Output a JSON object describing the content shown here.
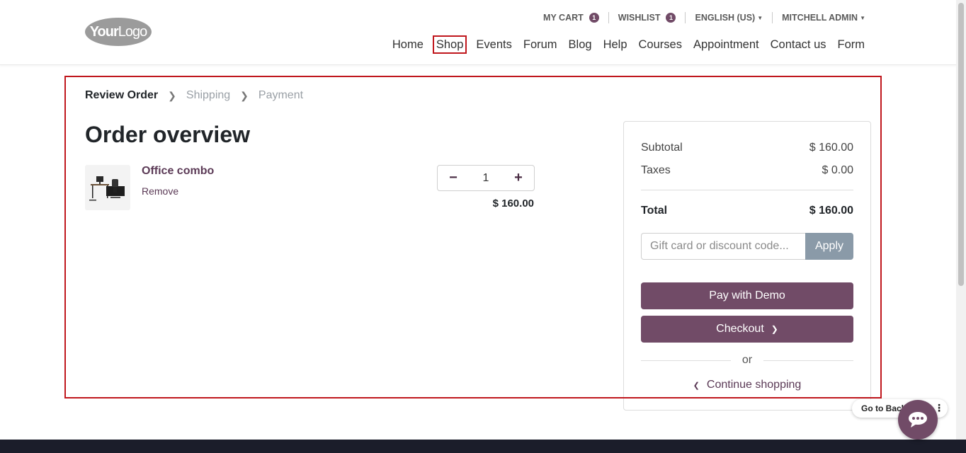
{
  "header": {
    "logo_text_1": "Your",
    "logo_text_2": "Logo",
    "topbar": {
      "cart_label": "MY CART",
      "cart_count": "1",
      "wishlist_label": "WISHLIST",
      "wishlist_count": "1",
      "language": "ENGLISH (US)",
      "user": "MITCHELL ADMIN"
    },
    "nav": [
      "Home",
      "Shop",
      "Events",
      "Forum",
      "Blog",
      "Help",
      "Courses",
      "Appointment",
      "Contact us",
      "Form"
    ]
  },
  "checkout": {
    "steps": [
      "Review Order",
      "Shipping",
      "Payment"
    ],
    "title": "Order overview",
    "line": {
      "name": "Office combo",
      "remove": "Remove",
      "qty": "1",
      "price": "$ 160.00"
    }
  },
  "summary": {
    "subtotal_label": "Subtotal",
    "subtotal": "$ 160.00",
    "taxes_label": "Taxes",
    "taxes": "$ 0.00",
    "total_label": "Total",
    "total": "$ 160.00",
    "coupon_placeholder": "Gift card or discount code...",
    "apply": "Apply",
    "pay_demo": "Pay with Demo",
    "checkout": "Checkout",
    "or": "or",
    "continue": "Continue shopping"
  },
  "widgets": {
    "go_back": "Go to Backend"
  },
  "colors": {
    "brand": "#714b67",
    "highlight": "#c0171d",
    "apply_button": "#8a9aa8",
    "footer": "#1b1d2a"
  }
}
